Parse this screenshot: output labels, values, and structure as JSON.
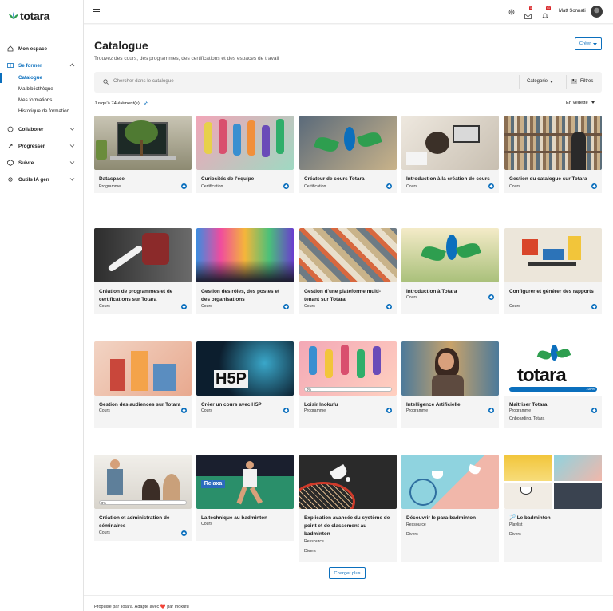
{
  "brand": {
    "name": "totara",
    "accent": "#0b6fbd",
    "green": "#2e9e4f"
  },
  "sidebar": {
    "items": [
      {
        "label": "Mon espace",
        "icon": "home-icon"
      },
      {
        "label": "Se former",
        "icon": "book-icon",
        "expanded": true
      },
      {
        "label": "Collaborer",
        "icon": "chat-icon"
      },
      {
        "label": "Progresser",
        "icon": "rocket-icon"
      },
      {
        "label": "Suivre",
        "icon": "cube-icon"
      },
      {
        "label": "Outils IA gen",
        "icon": "gear-icon"
      }
    ],
    "subitems": [
      "Catalogue",
      "Ma bibliothèque",
      "Mes formations",
      "Historique de formation"
    ]
  },
  "topbar": {
    "user": "Matt Sonnati",
    "message_badge": "1",
    "notif_badge": "41"
  },
  "page": {
    "title": "Catalogue",
    "subtitle": "Trouvez des cours, des programmes, des certifications et des espaces de travail",
    "create_label": "Créer",
    "search_placeholder": "Chercher dans le catalogue",
    "category_label": "Catégorie",
    "filters_label": "Filtres",
    "count": "Jusqu'à 74 élément(s)",
    "sort_label": "En vedette",
    "load_more": "Charger plus"
  },
  "cards": [
    {
      "title": "Dataspace",
      "type": "Programme"
    },
    {
      "title": "Curiosités de l'équipe",
      "type": "Certification"
    },
    {
      "title": "Créateur de cours Totara",
      "type": "Certification"
    },
    {
      "title": "Introduction à la création de cours",
      "type": "Cours"
    },
    {
      "title": "Gestion du catalogue sur Totara",
      "type": "Cours"
    },
    {
      "title": "Création de programmes et de certifications sur Totara",
      "type": "Cours"
    },
    {
      "title": "Gestion des rôles, des postes et des organisations",
      "type": "Cours"
    },
    {
      "title": "Gestion d'une plateforme multi-tenant sur Totara",
      "type": "Cours"
    },
    {
      "title": "Introduction à Totara",
      "type": "Cours"
    },
    {
      "title": "Configurer et générer des rapports",
      "type": "Cours"
    },
    {
      "title": "Gestion des audiences sur Totara",
      "type": "Cours"
    },
    {
      "title": "Créer un cours avec H5P",
      "type": "Cours"
    },
    {
      "title": "Loisir Inokufu",
      "type": "Programme",
      "progress": "0%"
    },
    {
      "title": "Intelligence Artificielle",
      "type": "Programme"
    },
    {
      "title": "Maitriser Totara",
      "type": "Programme",
      "progress": "100%",
      "tags": "Onboarding, Totara"
    },
    {
      "title": "Création et administration de séminaires",
      "type": "Cours",
      "progress": "0%"
    },
    {
      "title": "La technique au badminton",
      "type": "Cours"
    },
    {
      "title": "Explication avancée du système de point et de classement au badminton",
      "type": "Ressource",
      "tags": "Divers"
    },
    {
      "title": "Découvrir le para-badminton",
      "type": "Ressource",
      "tags": "Divers"
    },
    {
      "title": "🏸 Le badminton",
      "type": "Playlist",
      "tags": "Divers"
    }
  ],
  "footer": {
    "prefix": "Propulsé par",
    "link1": "Totara",
    "middle": ". Adapté avec",
    "heart": "❤️",
    "by": "par",
    "link2": "Inokufu"
  },
  "image_art": {
    "totara_word": "totara",
    "h5p_word": "H5P",
    "relaxa_word": "Relaxa"
  }
}
